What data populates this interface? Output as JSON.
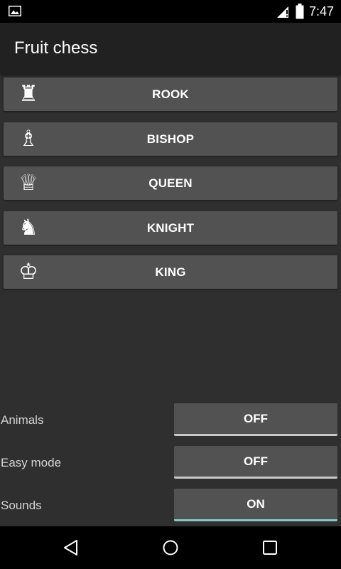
{
  "status_bar": {
    "time": "7:47",
    "left_icon": "image-icon",
    "signal_icon": "signal-icon",
    "battery_icon": "battery-icon"
  },
  "app": {
    "title": "Fruit chess"
  },
  "pieces": [
    {
      "label": "ROOK",
      "icon": "rook-icon",
      "glyph": "♜"
    },
    {
      "label": "BISHOP",
      "icon": "bishop-icon",
      "glyph": "♗"
    },
    {
      "label": "QUEEN",
      "icon": "queen-icon",
      "glyph": "♕"
    },
    {
      "label": "KNIGHT",
      "icon": "knight-icon",
      "glyph": "♞"
    },
    {
      "label": "KING",
      "icon": "king-icon",
      "glyph": "♔"
    }
  ],
  "settings": [
    {
      "label": "Animals",
      "value": "OFF"
    },
    {
      "label": "Easy mode",
      "value": "OFF"
    },
    {
      "label": "Sounds",
      "value": "ON"
    }
  ],
  "colors": {
    "background": "#2f2f2f",
    "action_bar": "#212121",
    "button": "#525252",
    "toggle_on_accent": "#7fc9c0",
    "toggle_off_accent": "#c8c8c8"
  },
  "nav_bar": {
    "back_icon": "back-icon",
    "home_icon": "home-icon",
    "recents_icon": "recents-icon"
  }
}
